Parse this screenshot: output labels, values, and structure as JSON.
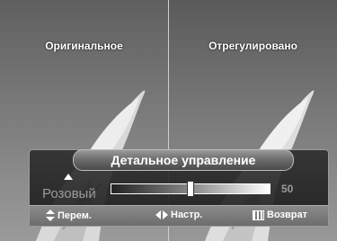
{
  "preview": {
    "left_label": "Оригинальное",
    "right_label": "Отрегулировано"
  },
  "panel": {
    "title": "Детальное управление",
    "param_label": "Розовый",
    "value": "50",
    "slider_fraction": 0.5
  },
  "hints": {
    "move": "Перем.",
    "adjust": "Настр.",
    "return": "Возврат"
  }
}
